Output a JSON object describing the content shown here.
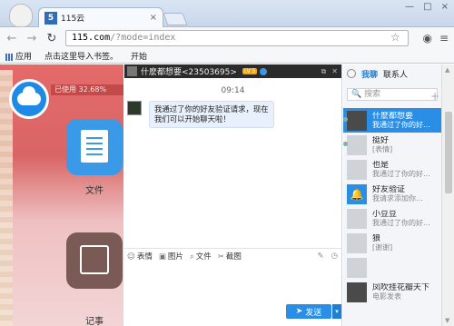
{
  "browser": {
    "tab_logo": "5",
    "tab_title": "115云",
    "tab_close": "×",
    "window_buttons": [
      "—",
      "□",
      "×"
    ],
    "url_host": "115.com",
    "url_path": "/?mode=index",
    "bookmarks": [
      {
        "label": "应用"
      },
      {
        "label": "点击这里导入书签。"
      },
      {
        "label": "开始"
      }
    ]
  },
  "cloud_app": {
    "usage": "已使用 32.68%",
    "tiles": [
      {
        "label": "文件"
      },
      {
        "label": "记事"
      }
    ]
  },
  "chat": {
    "title": "什麽都想要<23503695>",
    "level": "LV 5",
    "time": "09:14",
    "message": "我通过了你的好友验证请求，现在我们可以开始聊天啦！",
    "tools": [
      "表情",
      "图片",
      "文件",
      "截图"
    ],
    "send_label": "发送",
    "send_arrow": "▾"
  },
  "contacts": {
    "tabs": [
      "我聊",
      "联系人"
    ],
    "search_placeholder": "搜索",
    "items": [
      {
        "name": "什麽都想要",
        "msg": "我通过了你的好…",
        "selected": true
      },
      {
        "name": "挺好",
        "msg": "[表情]",
        "selected": false
      },
      {
        "name": "也是",
        "msg": "我通过了你的好…",
        "selected": false
      },
      {
        "name": "好友验证",
        "msg": "我请求添加你…",
        "selected": false
      },
      {
        "name": "小豆豆",
        "msg": "我通过了你的好…",
        "selected": false
      },
      {
        "name": "狼",
        "msg": "[谢谢]",
        "selected": false
      },
      {
        "name": "",
        "msg": "",
        "selected": false
      },
      {
        "name": "凤吹挂花瓣天下",
        "msg": "电影发表",
        "selected": false
      }
    ]
  }
}
